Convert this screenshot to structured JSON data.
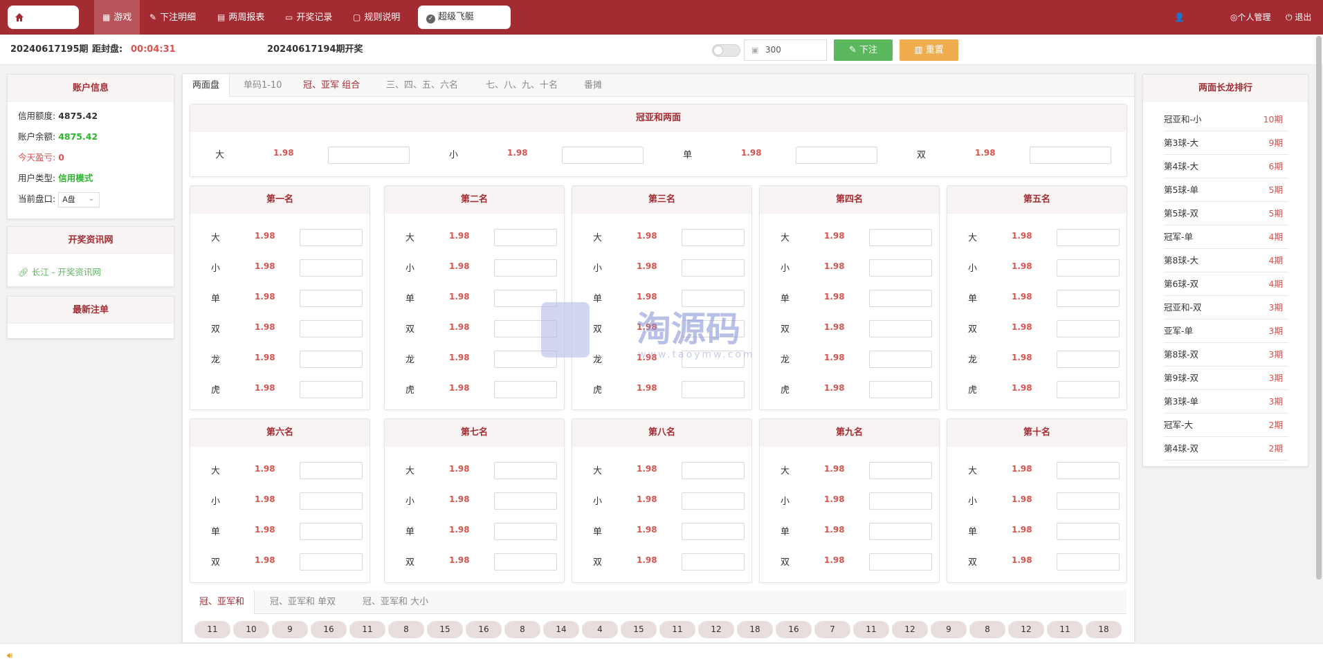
{
  "nav": {
    "items": [
      {
        "label": "游戏"
      },
      {
        "label": "下注明细"
      },
      {
        "label": "两周报表"
      },
      {
        "label": "开奖记录"
      },
      {
        "label": "规则说明"
      }
    ],
    "game": "超级飞艇",
    "right": [
      {
        "label": "个人管理"
      },
      {
        "label": "退出"
      }
    ]
  },
  "bar": {
    "period": "20240617195期",
    "close_label": "距封盘:",
    "countdown": "00:04:31",
    "last_draw": "20240617194期开奖",
    "amount": "300",
    "bet_label": "下注",
    "reset_label": "重置"
  },
  "account": {
    "title": "账户信息",
    "rows": [
      {
        "label": "信用额度:",
        "value": "4875.42"
      },
      {
        "label": "账户余额:",
        "value": "4875.42"
      },
      {
        "label": "今天盈亏:",
        "value": "0"
      },
      {
        "label": "用户类型:",
        "value": "信用模式"
      },
      {
        "label": "当前盘口:",
        "value": "A盘"
      }
    ]
  },
  "news": {
    "title": "开奖资讯网",
    "link": "长江 - 开奖资讯网"
  },
  "latest": {
    "title": "最新注单"
  },
  "tabs": [
    "两面盘",
    "单码1-10",
    "冠、亚军 组合",
    "三、四、五、六名",
    "七、八、九、十名",
    "番摊"
  ],
  "sum_section": {
    "title": "冠亚和两面",
    "items": [
      {
        "label": "大",
        "odds": "1.98"
      },
      {
        "label": "小",
        "odds": "1.98"
      },
      {
        "label": "单",
        "odds": "1.98"
      },
      {
        "label": "双",
        "odds": "1.98"
      }
    ]
  },
  "ranks_top": [
    {
      "title": "第一名",
      "items": [
        {
          "label": "大",
          "odds": "1.98"
        },
        {
          "label": "小",
          "odds": "1.98"
        },
        {
          "label": "单",
          "odds": "1.98"
        },
        {
          "label": "双",
          "odds": "1.98"
        },
        {
          "label": "龙",
          "odds": "1.98"
        },
        {
          "label": "虎",
          "odds": "1.98"
        }
      ]
    },
    {
      "title": "第二名",
      "items": [
        {
          "label": "大",
          "odds": "1.98"
        },
        {
          "label": "小",
          "odds": "1.98"
        },
        {
          "label": "单",
          "odds": "1.98"
        },
        {
          "label": "双",
          "odds": "1.98"
        },
        {
          "label": "龙",
          "odds": "1.98"
        },
        {
          "label": "虎",
          "odds": "1.98"
        }
      ]
    },
    {
      "title": "第三名",
      "items": [
        {
          "label": "大",
          "odds": "1.98"
        },
        {
          "label": "小",
          "odds": "1.98"
        },
        {
          "label": "单",
          "odds": "1.98"
        },
        {
          "label": "双",
          "odds": "1.98"
        },
        {
          "label": "龙",
          "odds": "1.98"
        },
        {
          "label": "虎",
          "odds": "1.98"
        }
      ]
    },
    {
      "title": "第四名",
      "items": [
        {
          "label": "大",
          "odds": "1.98"
        },
        {
          "label": "小",
          "odds": "1.98"
        },
        {
          "label": "单",
          "odds": "1.98"
        },
        {
          "label": "双",
          "odds": "1.98"
        },
        {
          "label": "龙",
          "odds": "1.98"
        },
        {
          "label": "虎",
          "odds": "1.98"
        }
      ]
    },
    {
      "title": "第五名",
      "items": [
        {
          "label": "大",
          "odds": "1.98"
        },
        {
          "label": "小",
          "odds": "1.98"
        },
        {
          "label": "单",
          "odds": "1.98"
        },
        {
          "label": "双",
          "odds": "1.98"
        },
        {
          "label": "龙",
          "odds": "1.98"
        },
        {
          "label": "虎",
          "odds": "1.98"
        }
      ]
    }
  ],
  "ranks_bottom": [
    {
      "title": "第六名",
      "items": [
        {
          "label": "大",
          "odds": "1.98"
        },
        {
          "label": "小",
          "odds": "1.98"
        },
        {
          "label": "单",
          "odds": "1.98"
        },
        {
          "label": "双",
          "odds": "1.98"
        }
      ]
    },
    {
      "title": "第七名",
      "items": [
        {
          "label": "大",
          "odds": "1.98"
        },
        {
          "label": "小",
          "odds": "1.98"
        },
        {
          "label": "单",
          "odds": "1.98"
        },
        {
          "label": "双",
          "odds": "1.98"
        }
      ]
    },
    {
      "title": "第八名",
      "items": [
        {
          "label": "大",
          "odds": "1.98"
        },
        {
          "label": "小",
          "odds": "1.98"
        },
        {
          "label": "单",
          "odds": "1.98"
        },
        {
          "label": "双",
          "odds": "1.98"
        }
      ]
    },
    {
      "title": "第九名",
      "items": [
        {
          "label": "大",
          "odds": "1.98"
        },
        {
          "label": "小",
          "odds": "1.98"
        },
        {
          "label": "单",
          "odds": "1.98"
        },
        {
          "label": "双",
          "odds": "1.98"
        }
      ]
    },
    {
      "title": "第十名",
      "items": [
        {
          "label": "大",
          "odds": "1.98"
        },
        {
          "label": "小",
          "odds": "1.98"
        },
        {
          "label": "单",
          "odds": "1.98"
        },
        {
          "label": "双",
          "odds": "1.98"
        }
      ]
    }
  ],
  "longdragon": {
    "title": "两面长龙排行",
    "rows": [
      {
        "name": "冠亚和-小",
        "count": "10期"
      },
      {
        "name": "第3球-大",
        "count": "9期"
      },
      {
        "name": "第4球-大",
        "count": "6期"
      },
      {
        "name": "第5球-单",
        "count": "5期"
      },
      {
        "name": "第5球-双",
        "count": "5期"
      },
      {
        "name": "冠军-单",
        "count": "4期"
      },
      {
        "name": "第8球-大",
        "count": "4期"
      },
      {
        "name": "第6球-双",
        "count": "4期"
      },
      {
        "name": "冠亚和-双",
        "count": "3期"
      },
      {
        "name": "亚军-单",
        "count": "3期"
      },
      {
        "name": "第8球-双",
        "count": "3期"
      },
      {
        "name": "第9球-双",
        "count": "3期"
      },
      {
        "name": "第3球-单",
        "count": "3期"
      },
      {
        "name": "冠军-大",
        "count": "2期"
      },
      {
        "name": "第4球-双",
        "count": "2期"
      }
    ]
  },
  "bottom_tabs": [
    "冠、亚军和",
    "冠、亚军和 单双",
    "冠、亚军和 大小"
  ],
  "history": [
    "11",
    "10",
    "9",
    "16",
    "11",
    "8",
    "15",
    "16",
    "8",
    "14",
    "4",
    "15",
    "11",
    "12",
    "18",
    "16",
    "7",
    "11",
    "12",
    "9",
    "8",
    "12",
    "11",
    "18"
  ],
  "watermark": {
    "text": "淘源码",
    "sub": "www.taoymw.com"
  },
  "colors": {
    "brand": "#a32b32",
    "odds": "#d9534f",
    "green": "#5cb85c",
    "orange": "#f0ad4e"
  }
}
